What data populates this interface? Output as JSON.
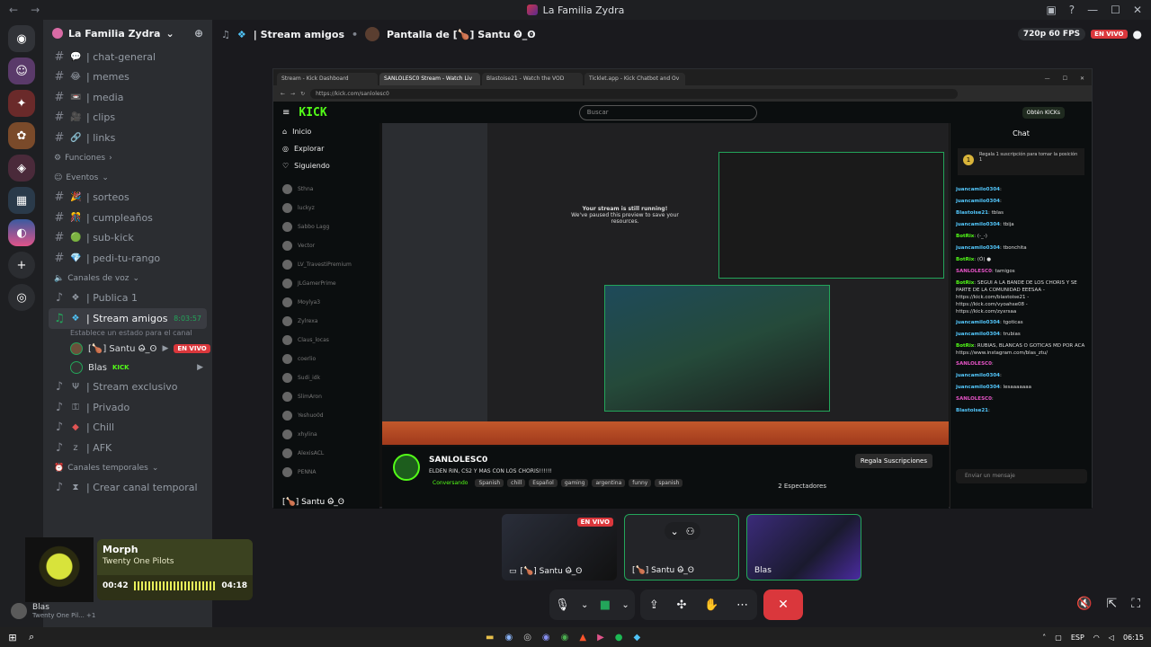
{
  "window": {
    "title": "La Familia Zydra"
  },
  "guild": {
    "name": "La Familia Zydra"
  },
  "channels": [
    {
      "name": "| chat-general",
      "emoji": "💬"
    },
    {
      "name": "| memes",
      "emoji": "😂"
    },
    {
      "name": "| media",
      "emoji": "📼"
    },
    {
      "name": "| clips",
      "emoji": "🎥"
    },
    {
      "name": "| links",
      "emoji": "🔗"
    }
  ],
  "categories": {
    "funciones": "Funciones",
    "eventos": "Eventos",
    "voz": "Canales de voz",
    "temporales": "Canales temporales"
  },
  "event_channels": [
    {
      "name": "| sorteos",
      "emoji": "🎉"
    },
    {
      "name": "| cumpleaños",
      "emoji": "🎊"
    },
    {
      "name": "| sub-kick",
      "emoji": "🟢"
    },
    {
      "name": "| pedi-tu-rango",
      "emoji": "💎"
    }
  ],
  "voice": {
    "publica": "| Publica 1",
    "active": "| Stream amigos",
    "timer": "8:03:57",
    "status": "Establece un estado para el canal",
    "users": [
      {
        "name": "[🍗] Santu ʘ̶̀_ʘ",
        "badge": "EN VIVO"
      },
      {
        "name": "Blas",
        "tag": "KICK"
      }
    ],
    "others": [
      "| Stream exclusivo",
      "| Privado",
      "| Chill",
      "| AFK"
    ],
    "temp": "| Crear canal temporal"
  },
  "music": {
    "song": "Morph",
    "artist": "Twenty One Pilots",
    "elapsed": "00:42",
    "duration": "04:18"
  },
  "user_panel": {
    "name": "Blas",
    "sub": "Twenty One Pil... +1"
  },
  "header": {
    "channel": "| Stream amigos",
    "screen": "Pantalla de [🍗] Santu ʘ̶̀_ʘ",
    "quality": "720p 60 FPS",
    "live": "EN VIVO"
  },
  "browser": {
    "tabs": [
      "Stream - Kick Dashboard",
      "SANLOLESC0 Stream - Watch Liv",
      "Blastoise21 - Watch the VOD",
      "Ticklet.app - Kick Chatbot and Ov"
    ],
    "url": "https://kick.com/sanlolesc0"
  },
  "kick": {
    "logo": "KICK",
    "search": "Buscar",
    "obtain": "Obtén KICKs",
    "nav": [
      "Inicio",
      "Explorar",
      "Siguiendo"
    ],
    "following": [
      "Sthna",
      "luckyz",
      "Sabbo Lagg",
      "Vector",
      "LV_TravestiPremium",
      "JLGamerPrime",
      "Moylya3",
      "Zylrexa",
      "Claus_locas",
      "coerlio",
      "Sudi_idk",
      "SlimAron",
      "Yeshuo0d",
      "xhylina",
      "AlexisACL",
      "PENNA"
    ],
    "footer_user": "[🍗] Santu ʘ̶̀_ʘ",
    "stream_msg_1": "Your stream is still running!",
    "stream_msg_2": "We've paused this preview to save your resources.",
    "channel": "SANLOLESC0",
    "title": "ELDEN RIN, CS2 Y MAS CON LOS CHORIS!!!!!!",
    "conv": "Conversando",
    "tags": [
      "Spanish",
      "chill",
      "Español",
      "gaming",
      "argentina",
      "funny",
      "spanish"
    ],
    "regala": "Regala Suscripciones",
    "viewers": "2 Espectadores",
    "chat_title": "Chat",
    "pin": "Regala 1 suscripción para tomar la posición 1",
    "chat": [
      {
        "user": "juancamilo0304",
        "text": ":",
        "kind": "u"
      },
      {
        "user": "juancamilo0304",
        "text": ":",
        "kind": "u"
      },
      {
        "user": "Blastoise21",
        "text": ": tblas",
        "kind": "u"
      },
      {
        "user": "juancamilo0304",
        "text": ": tbija",
        "kind": "u"
      },
      {
        "user": "BotRix",
        "text": ": (-_-) ",
        "kind": "b"
      },
      {
        "user": "juancamilo0304",
        "text": ": tbonchita",
        "kind": "u"
      },
      {
        "user": "BotRix",
        "text": ": (Ó) ●",
        "kind": "b"
      },
      {
        "user": "SANLOLESC0",
        "text": ": tamigos",
        "kind": "s"
      },
      {
        "user": "BotRix",
        "text": ": SEGUI A LA BANDE DE LOS CHORIS Y SE PARTE DE LA COMUNIDAD EEESAA - https://kick.com/blastoise21 - https://kick.com/vyoahse08 - https://kick.com/zyxrsaa",
        "kind": "b"
      },
      {
        "user": "juancamilo0304",
        "text": ": tgoticas",
        "kind": "u"
      },
      {
        "user": "juancamilo0304",
        "text": ": trubias",
        "kind": "u"
      },
      {
        "user": "BotRix",
        "text": ": RUBIAS, BLANCAS O GOTICAS MD POR ACA https://www.instagram.com/blas_ztu/",
        "kind": "b"
      },
      {
        "user": "SANLOLESC0",
        "text": ":",
        "kind": "s"
      },
      {
        "user": "juancamilo0304",
        "text": ":",
        "kind": "u"
      },
      {
        "user": "juancamilo0304",
        "text": ": lesaaaaaaa",
        "kind": "u"
      },
      {
        "user": "SANLOLESC0",
        "text": ":",
        "kind": "s"
      },
      {
        "user": "Blastoise21",
        "text": ":",
        "kind": "u"
      }
    ],
    "chat_input": "Enviar un mensaje"
  },
  "tiles": [
    {
      "label": "[🍗] Santu ʘ̶̀_ʘ",
      "live": "EN VIVO"
    },
    {
      "label": "[🍗] Santu ʘ̶̀_ʘ"
    },
    {
      "label": "Blas"
    }
  ],
  "taskbar": {
    "lang": "ESP",
    "time": "06:15"
  }
}
